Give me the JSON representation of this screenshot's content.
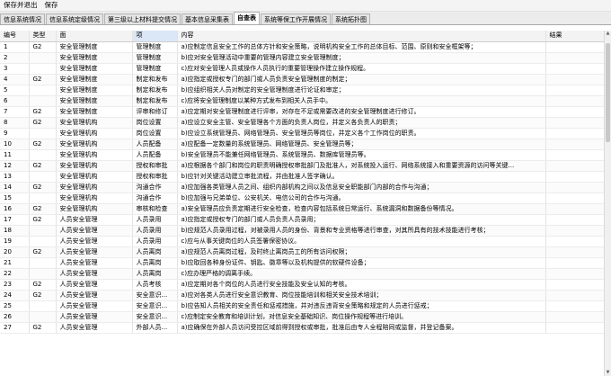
{
  "menu": {
    "save_exit": "保存并退出",
    "save": "保存"
  },
  "tabs": [
    {
      "label": "信息系统情况",
      "active": false
    },
    {
      "label": "信息系统定级情况",
      "active": false
    },
    {
      "label": "第三级以上材料提交情况",
      "active": false
    },
    {
      "label": "基本信息采集表",
      "active": false
    },
    {
      "label": "自查表",
      "active": true
    },
    {
      "label": "系统等保工作开展情况",
      "active": false
    },
    {
      "label": "系统拓扑图",
      "active": false
    }
  ],
  "table": {
    "columns": [
      "编号",
      "类型",
      "面",
      "项",
      "内容",
      "结果"
    ],
    "rows": [
      [
        "1",
        "G2",
        "安全管理制度",
        "管理制度",
        "a)应制定信息安全工作的总体方针和安全策略，说明机构安全工作的总体目标、范围、原则和安全框架等；",
        ""
      ],
      [
        "2",
        "",
        "安全管理制度",
        "管理制度",
        "b)应对安全管理活动中重要的管理内容建立安全管理制度；",
        ""
      ],
      [
        "3",
        "",
        "安全管理制度",
        "管理制度",
        "c)应对安全管理人员或操作人员执行的重要管理操作建立操作规程。",
        ""
      ],
      [
        "4",
        "G2",
        "安全管理制度",
        "制定和发布",
        "a)应指定或授权专门的部门或人员负责安全管理制度的制定；",
        ""
      ],
      [
        "5",
        "",
        "安全管理制度",
        "制定和发布",
        "b)应组织相关人员对制定的安全管理制度进行论证和审定；",
        ""
      ],
      [
        "6",
        "",
        "安全管理制度",
        "制定和发布",
        "c)应将安全管理制度以某种方式发布到相关人员手中。",
        ""
      ],
      [
        "7",
        "G2",
        "安全管理制度",
        "评审和修订",
        "a)应定期对安全管理制度进行评审，对存在不足或需要改进的安全管理制度进行修订。",
        ""
      ],
      [
        "8",
        "G2",
        "安全管理机构",
        "岗位设置",
        "a)应设立安全主管、安全管理各个方面的负责人岗位，并定义各负责人的职责；",
        ""
      ],
      [
        "9",
        "",
        "安全管理机构",
        "岗位设置",
        "b)应设立系统管理员、网络管理员、安全管理员等岗位，并定义各个工作岗位的职责。",
        ""
      ],
      [
        "10",
        "G2",
        "安全管理机构",
        "人员配备",
        "a)应配备一定数量的系统管理员、网络管理员、安全管理员等；",
        ""
      ],
      [
        "11",
        "",
        "安全管理机构",
        "人员配备",
        "b)安全管理员不能兼任网络管理员、系统管理员、数据库管理员等。",
        ""
      ],
      [
        "12",
        "G2",
        "安全管理机构",
        "授权和审批",
        "a)应根据各个部门和岗位的职责明确授权审批部门及批准人，对系统投入运行、网络系统接入和重要资源的访问等关键...",
        ""
      ],
      [
        "13",
        "",
        "安全管理机构",
        "授权和审批",
        "b)应针对关键活动建立审批流程，并由批准人签字确认。",
        ""
      ],
      [
        "14",
        "G2",
        "安全管理机构",
        "沟通合作",
        "a)应加强各类管理人员之间、组织内部机构之间以及信息安全职能部门内部的合作与沟通；",
        ""
      ],
      [
        "15",
        "",
        "安全管理机构",
        "沟通合作",
        "b)应加强与兄弟单位、公安机关、电信公司的合作与沟通。",
        ""
      ],
      [
        "16",
        "G2",
        "安全管理机构",
        "审核和检查",
        "a)安全管理员应负责定期进行安全检查，检查内容包括系统日常运行、系统漏洞和数据备份等情况。",
        ""
      ],
      [
        "17",
        "G2",
        "人员安全管理",
        "人员录用",
        "a)应指定或授权专门的部门或人员负责人员录用；",
        ""
      ],
      [
        "18",
        "",
        "人员安全管理",
        "人员录用",
        "b)应规范人员录用过程，对被录用人员的身份、背景和专业资格等进行审查，对其所具有的技术技能进行考核；",
        ""
      ],
      [
        "19",
        "",
        "人员安全管理",
        "人员录用",
        "c)应与从事关键岗位的人员签署保密协议。",
        ""
      ],
      [
        "20",
        "G2",
        "人员安全管理",
        "人员离岗",
        "a)应规范人员离岗过程，及时终止离岗员工的所有访问权限；",
        ""
      ],
      [
        "21",
        "",
        "人员安全管理",
        "人员离岗",
        "b)应取回各种身份证件、钥匙、徽章等以及机构提供的软硬件设备；",
        ""
      ],
      [
        "22",
        "",
        "人员安全管理",
        "人员离岗",
        "c)应办理严格的调离手续。",
        ""
      ],
      [
        "23",
        "G2",
        "人员安全管理",
        "人员考核",
        "a)应定期对各个岗位的人员进行安全技能及安全认知的考核。",
        ""
      ],
      [
        "24",
        "G2",
        "人员安全管理",
        "安全意识...",
        "a)应对各类人员进行安全意识教育、岗位技能培训和相关安全技术培训；",
        ""
      ],
      [
        "25",
        "",
        "人员安全管理",
        "安全意识...",
        "b)应告知人员相关的安全责任和惩戒措施，并对违反违背安全策略和规定的人员进行惩戒；",
        ""
      ],
      [
        "26",
        "",
        "人员安全管理",
        "安全意识...",
        "c)应制定安全教育和培训计划，对信息安全基础知识、岗位操作规程等进行培训。",
        ""
      ],
      [
        "27",
        "G2",
        "人员安全管理",
        "外部人员...",
        "a)应确保在外部人员访问受控区域前得到授权或审批，批准后由专人全程陪同或监督，并登记备案。",
        ""
      ]
    ]
  }
}
